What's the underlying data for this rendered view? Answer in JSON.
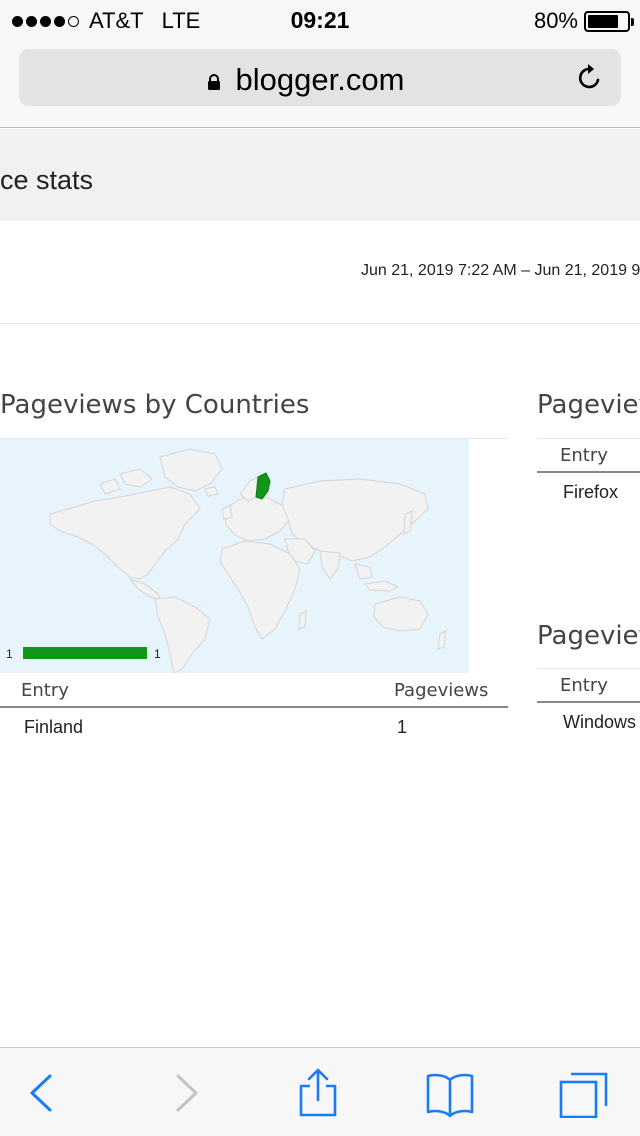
{
  "status_bar": {
    "carrier": "AT&T",
    "network": "LTE",
    "time": "09:21",
    "battery_percent": "80%",
    "battery_level": 0.8,
    "signal_bars_filled": 4,
    "signal_bars_total": 5
  },
  "browser": {
    "url": "blogger.com",
    "secure_icon": "lock-icon",
    "reload_icon": "reload-icon"
  },
  "page": {
    "title": "ce stats",
    "date_range": "Jun 21, 2019 7:22 AM – Jun 21, 2019 9"
  },
  "countries": {
    "title": "Pageviews by Countries",
    "legend_min": "1",
    "legend_max": "1",
    "highlight_color": "#109618",
    "table": {
      "columns": [
        "Entry",
        "Pageviews"
      ],
      "rows": [
        {
          "entry": "Finland",
          "pageviews": "1"
        }
      ]
    }
  },
  "browsers": {
    "title": "Pageviev",
    "column_entry": "Entry",
    "rows": [
      {
        "entry": "Firefox"
      }
    ]
  },
  "os": {
    "title": "Pageviev",
    "column_entry": "Entry",
    "rows": [
      {
        "entry": "Windows"
      }
    ]
  },
  "toolbar": {
    "icons": [
      "back-icon",
      "forward-icon",
      "share-icon",
      "bookmarks-icon",
      "tabs-icon"
    ],
    "accent": "#1a7cf5"
  }
}
